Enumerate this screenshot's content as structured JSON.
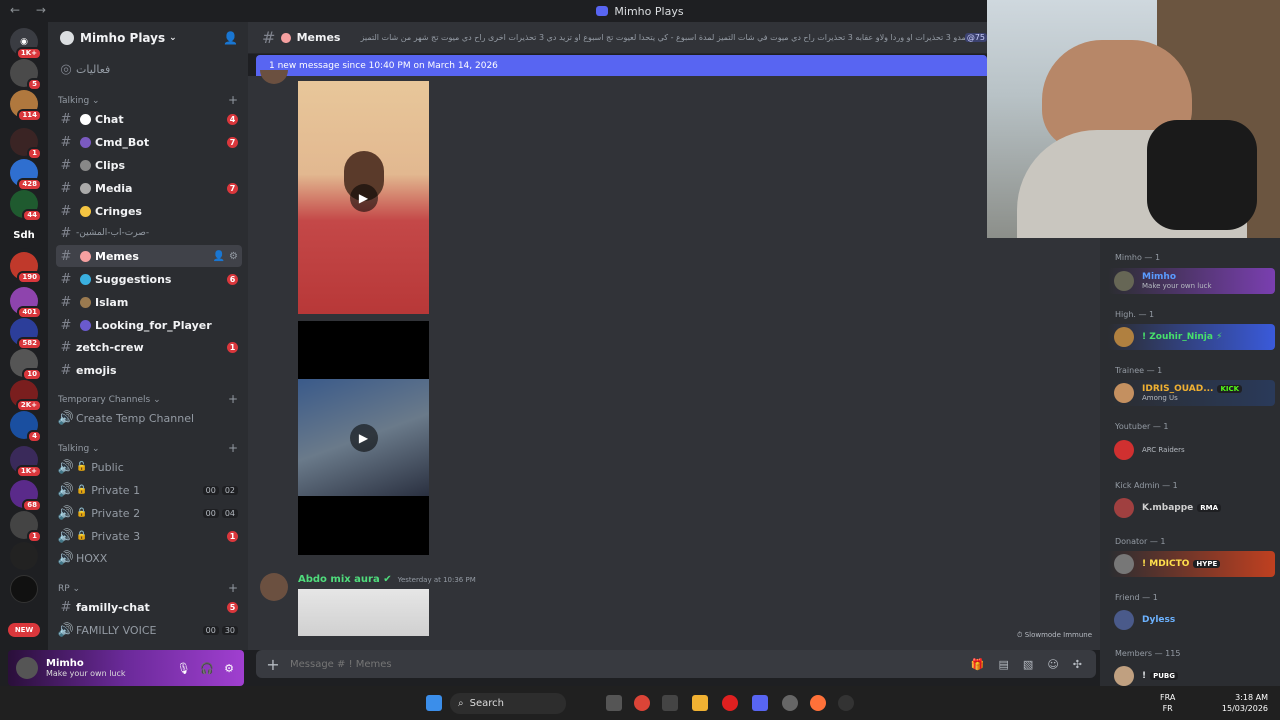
{
  "window": {
    "title": "Mimho Plays"
  },
  "rail": {
    "badges": [
      "1K+",
      "5",
      "114",
      "1",
      "428",
      "44",
      "190",
      "401",
      "582",
      "10",
      "2K+",
      "4",
      "1K+",
      "68",
      "1"
    ],
    "server_labels": [
      "Sdh"
    ],
    "new_badge": "NEW"
  },
  "sidebar": {
    "server_name": "Mimho Plays",
    "top_item": "فعاليات",
    "categories": {
      "talking": "Talking",
      "temp": "Temporary Channels",
      "talking_voice": "Talking",
      "rp": "RP"
    },
    "channels": [
      {
        "name": "Chat",
        "count": "4"
      },
      {
        "name": "Cmd_Bot",
        "count": "7"
      },
      {
        "name": "Clips",
        "count": ""
      },
      {
        "name": "Media",
        "count": "7"
      },
      {
        "name": "Cringes",
        "count": ""
      },
      {
        "name": "-صرت-اب-المشين-",
        "count": ""
      },
      {
        "name": "Memes",
        "count": ""
      },
      {
        "name": "Suggestions",
        "count": "6"
      },
      {
        "name": "Islam",
        "count": ""
      },
      {
        "name": "Looking_for_Player",
        "count": ""
      },
      {
        "name": "zetch-crew",
        "count": "1"
      },
      {
        "name": "emojis",
        "count": ""
      }
    ],
    "temp_channel": "Create Temp Channel",
    "voice": [
      {
        "name": "Public",
        "a": "",
        "b": ""
      },
      {
        "name": "Private 1",
        "a": "00",
        "b": "02"
      },
      {
        "name": "Private 2",
        "a": "00",
        "b": "04"
      },
      {
        "name": "Private 3",
        "a": "",
        "b": "1"
      },
      {
        "name": "HOXX",
        "a": "",
        "b": ""
      }
    ],
    "rp_channels": [
      {
        "name": "familly-chat",
        "count": "5"
      },
      {
        "name": "FAMILLY VOICE",
        "a": "00",
        "b": "30"
      }
    ]
  },
  "user": {
    "name": "Mimho",
    "status": "Make your own luck"
  },
  "chat": {
    "channel": "Memes",
    "topic": "ديرو عقوبات - تمدو 3 تحذيرات او وردا ولاو عقابه 3 تحذيرات راح دي ميوت في شات التميز لمدة اسبوع - كي يتحدا لعيوت تج اسبوع او تزيد دي 3 تحذيرات اخرى راح دي ميوت تج شهر من شات التميز",
    "mention": "@75",
    "new_messages": "1 new message since 10:40 PM on March 14, 2026",
    "author": "Abdo mix aura",
    "timestamp": "Yesterday at 10:36 PM",
    "slowmode": "Slowmode Immune",
    "placeholder": "Message # ! Memes"
  },
  "members": {
    "groups": [
      {
        "title": "Mimho — 1",
        "name": "Mimho",
        "sub": "Make your own luck",
        "color": "#5a9bff",
        "badge": ""
      },
      {
        "title": "High. — 1",
        "name": "! Zouhir_Ninja ⚡",
        "sub": "",
        "color": "#47e06b",
        "badge": ""
      },
      {
        "title": "Trainee — 1",
        "name": "IDRIS_OUAD...",
        "sub": "Among Us",
        "color": "#f0b132",
        "badge": "KICK"
      },
      {
        "title": "Youtuber — 1",
        "name": "",
        "sub": "ARC Raiders",
        "color": "#ff4040",
        "badge": ""
      },
      {
        "title": "Kick Admin — 1",
        "name": "K.mbappe",
        "sub": "",
        "color": "#d0d0d0",
        "badge": "RMA"
      },
      {
        "title": "Donator — 1",
        "name": "! MDICTO",
        "sub": "",
        "color": "#ffe04d",
        "badge": "HYPE"
      },
      {
        "title": "Friend — 1",
        "name": "Dyless",
        "sub": "",
        "color": "#6cb2ff",
        "badge": ""
      },
      {
        "title": "Members — 115",
        "name": "!",
        "sub": "",
        "color": "#dbdee1",
        "badge": "PUBG"
      }
    ]
  },
  "taskbar": {
    "search": "Search",
    "lang": "FRA",
    "lang2": "FR",
    "time": "3:18 AM",
    "date": "15/03/2026"
  },
  "colors": {
    "accent": "#5865f2",
    "badge": "#da373c",
    "bg": "#313338",
    "sidebar": "#2b2d31"
  }
}
